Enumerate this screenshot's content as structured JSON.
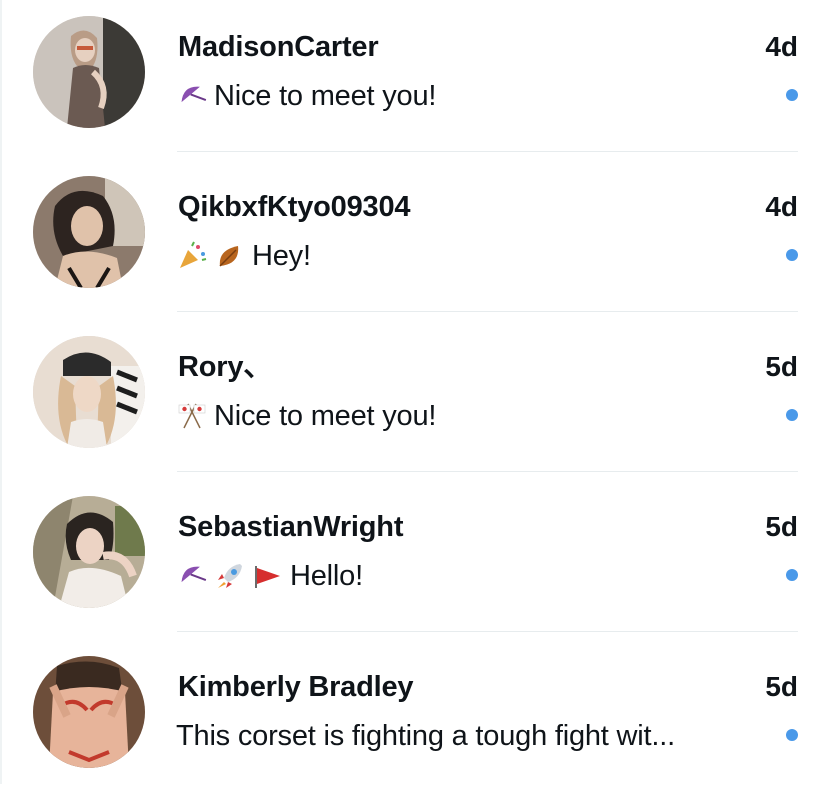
{
  "conversations": [
    {
      "name": "MadisonCarter",
      "time": "4d",
      "emojis": [
        "umbrella-icon"
      ],
      "preview": "Nice to meet you!",
      "unread": true,
      "avatar_colors": [
        "#c9c2bb",
        "#6b5a52",
        "#e6d4c6"
      ]
    },
    {
      "name": "QikbxfKtyo09304",
      "time": "4d",
      "emojis": [
        "party-popper-icon",
        "fallen-leaf-icon"
      ],
      "preview": "Hey!",
      "unread": true,
      "avatar_colors": [
        "#8c7a6c",
        "#2d2420",
        "#e0c2aa"
      ]
    },
    {
      "name": "Rory、",
      "time": "5d",
      "emojis": [
        "crossed-flags-icon"
      ],
      "preview": "Nice to meet you!",
      "unread": true,
      "avatar_colors": [
        "#e8ddd2",
        "#2b2b2b",
        "#d9b995"
      ]
    },
    {
      "name": "SebastianWright",
      "time": "5d",
      "emojis": [
        "umbrella-icon",
        "rocket-icon",
        "triangular-flag-icon"
      ],
      "preview": "Hello!",
      "unread": true,
      "avatar_colors": [
        "#9a9075",
        "#2a2420",
        "#ecd3c4"
      ]
    },
    {
      "name": "Kimberly Bradley",
      "time": "5d",
      "emojis": [],
      "preview": "This corset is fighting a tough fight wit...",
      "unread": true,
      "avatar_colors": [
        "#6d4e3a",
        "#c23a2c",
        "#e7b49a"
      ]
    }
  ],
  "colors": {
    "unread_dot": "#4a99e9",
    "divider": "#e7ecee",
    "text": "#0f1419"
  }
}
